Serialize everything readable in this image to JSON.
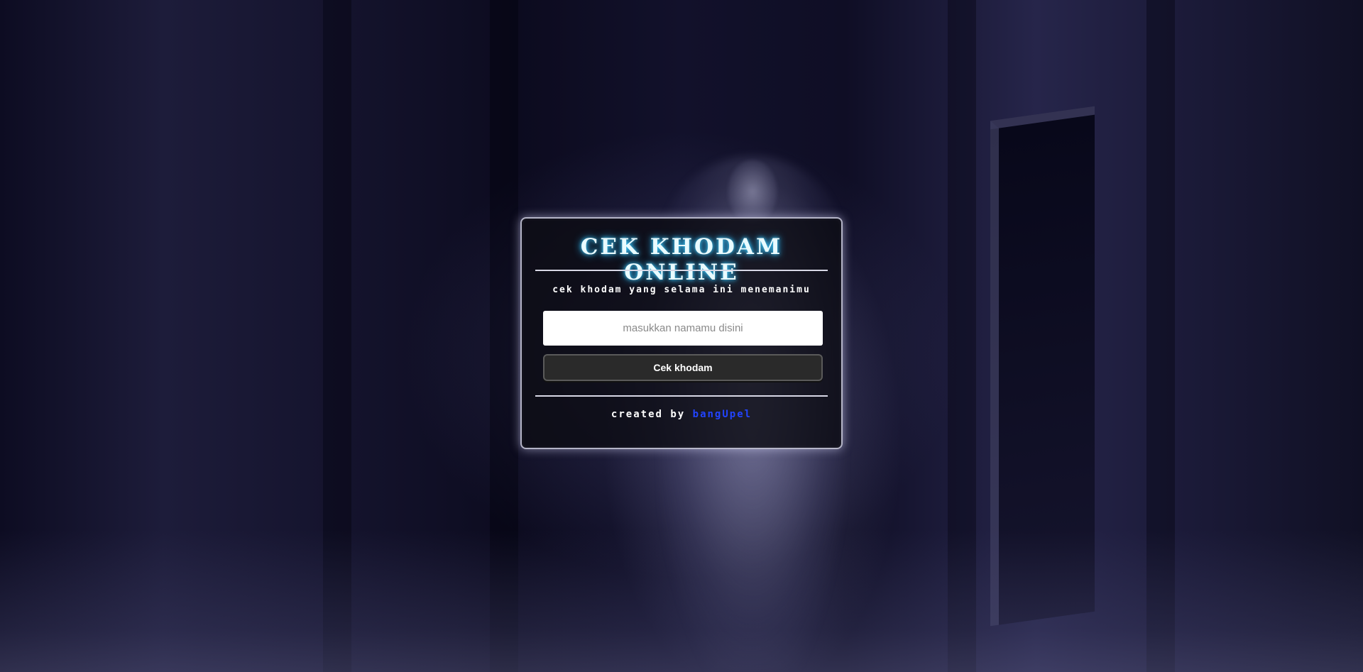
{
  "app": {
    "title": "CEK KHODAM ONLINE",
    "subtitle": "cek khodam yang selama ini menemanimu"
  },
  "form": {
    "name_placeholder": "masukkan namamu disini",
    "name_value": "",
    "submit_label": "Cek khodam"
  },
  "footer": {
    "prefix": "created by ",
    "author": "bangUpel"
  },
  "colors": {
    "title_glow": "#2bb8ff",
    "author_link": "#2244ff",
    "button_bg": "#2a2a2a"
  }
}
